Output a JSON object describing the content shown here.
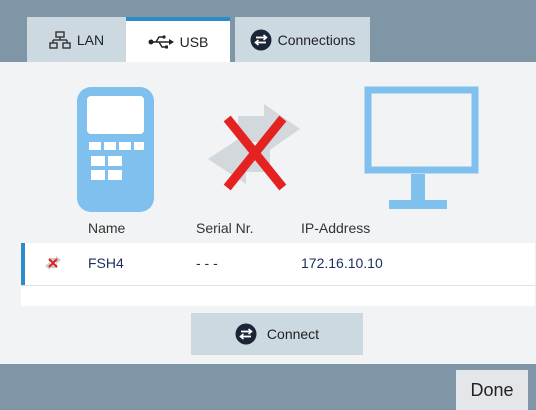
{
  "tabs": [
    {
      "label": "LAN",
      "icon": "network-icon",
      "active": false
    },
    {
      "label": "USB",
      "icon": "usb-icon",
      "active": true
    },
    {
      "label": "Connections",
      "icon": "connections-icon",
      "active": false
    }
  ],
  "illustration": {
    "device_icon": "handheld-device-icon",
    "status_icon": "disconnected-icon",
    "monitor_icon": "monitor-icon"
  },
  "table": {
    "headers": [
      "Name",
      "Serial Nr.",
      "IP-Address"
    ],
    "rows": [
      {
        "status_icon": "disconnected-icon",
        "name": "FSH4",
        "serial": "- - -",
        "ip": "172.16.10.10"
      }
    ]
  },
  "connect_label": "Connect",
  "done_label": "Done",
  "colors": {
    "bar": "#7f96a6",
    "tab": "#ccd9e1",
    "accent": "#2a8cc8",
    "illustration_blue": "#7fc0ef",
    "x_red": "#e42222",
    "table_text": "#1b2f5c"
  }
}
